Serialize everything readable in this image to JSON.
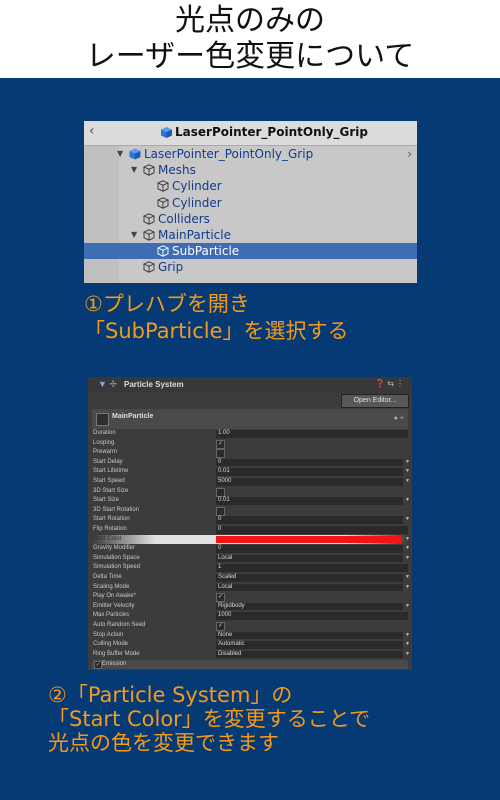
{
  "title": {
    "line1": "光点のみの",
    "line2": "レーザー色変更について"
  },
  "hierarchy": {
    "back_icon": "chevron-left-icon",
    "header_title": "LaserPointer_PointOnly_Grip",
    "items": [
      {
        "label": "LaserPointer_PointOnly_Grip",
        "expanded": true,
        "depth": 0,
        "selected": false,
        "kind": "prefab"
      },
      {
        "label": "Meshs",
        "expanded": true,
        "depth": 1,
        "selected": false,
        "kind": "gameobject"
      },
      {
        "label": "Cylinder",
        "depth": 2,
        "selected": false,
        "kind": "gameobject"
      },
      {
        "label": "Cylinder",
        "depth": 2,
        "selected": false,
        "kind": "gameobject"
      },
      {
        "label": "Colliders",
        "depth": 1,
        "selected": false,
        "kind": "gameobject"
      },
      {
        "label": "MainParticle",
        "expanded": true,
        "depth": 1,
        "selected": false,
        "kind": "gameobject"
      },
      {
        "label": "SubParticle",
        "depth": 2,
        "selected": true,
        "kind": "gameobject"
      },
      {
        "label": "Grip",
        "depth": 1,
        "selected": false,
        "kind": "gameobject"
      }
    ]
  },
  "step1": {
    "line1": "①プレハブを開き",
    "line2": "「SubParticle」を選択する"
  },
  "inspector": {
    "component_title": "Particle System",
    "open_editor": "Open Editor...",
    "system_name": "MainParticle",
    "rows": [
      {
        "label": "Duration",
        "value": "1.00"
      },
      {
        "label": "Looping",
        "check": "✓"
      },
      {
        "label": "Prewarm",
        "check": ""
      },
      {
        "label": "Start Delay",
        "value": "0",
        "dropdown": true
      },
      {
        "label": "Start Lifetime",
        "value": "0.01",
        "dropdown": true
      },
      {
        "label": "Start Speed",
        "value": "5000",
        "dropdown": true
      },
      {
        "label": "3D Start Size",
        "check": ""
      },
      {
        "label": "Start Size",
        "value": "0.01",
        "dropdown": true
      },
      {
        "label": "3D Start Rotation",
        "check": ""
      },
      {
        "label": "Start Rotation",
        "value": "0",
        "dropdown": true
      },
      {
        "label": "Flip Rotation",
        "value": "0"
      },
      {
        "label": "Start Color",
        "color": "#f31414",
        "highlight": true,
        "dropdown": true
      },
      {
        "label": "Gravity Modifier",
        "value": "0",
        "dropdown": true
      },
      {
        "label": "Simulation Space",
        "value": "Local",
        "dropdown": true
      },
      {
        "label": "Simulation Speed",
        "value": "1"
      },
      {
        "label": "Delta Time",
        "value": "Scaled",
        "dropdown": true
      },
      {
        "label": "Scaling Mode",
        "value": "Local",
        "dropdown": true
      },
      {
        "label": "Play On Awake*",
        "check": "✓"
      },
      {
        "label": "Emitter Velocity",
        "value": "Rigidbody",
        "dropdown": true
      },
      {
        "label": "Max Particles",
        "value": "1000"
      },
      {
        "label": "Auto Random Seed",
        "check": "✓"
      },
      {
        "label": "Stop Action",
        "value": "None",
        "dropdown": true
      },
      {
        "label": "Culling Mode",
        "value": "Automatic",
        "dropdown": true
      },
      {
        "label": "Ring Buffer Mode",
        "value": "Disabled",
        "dropdown": true
      }
    ],
    "emission_label": "Emission"
  },
  "step2": {
    "line1": "②「Particle System」の",
    "line2": "「Start Color」を変更することで",
    "line3": "光点の色を変更できます"
  },
  "colors": {
    "background": "#053a74",
    "accent": "#f39a1b",
    "selection": "#3e6db4"
  }
}
